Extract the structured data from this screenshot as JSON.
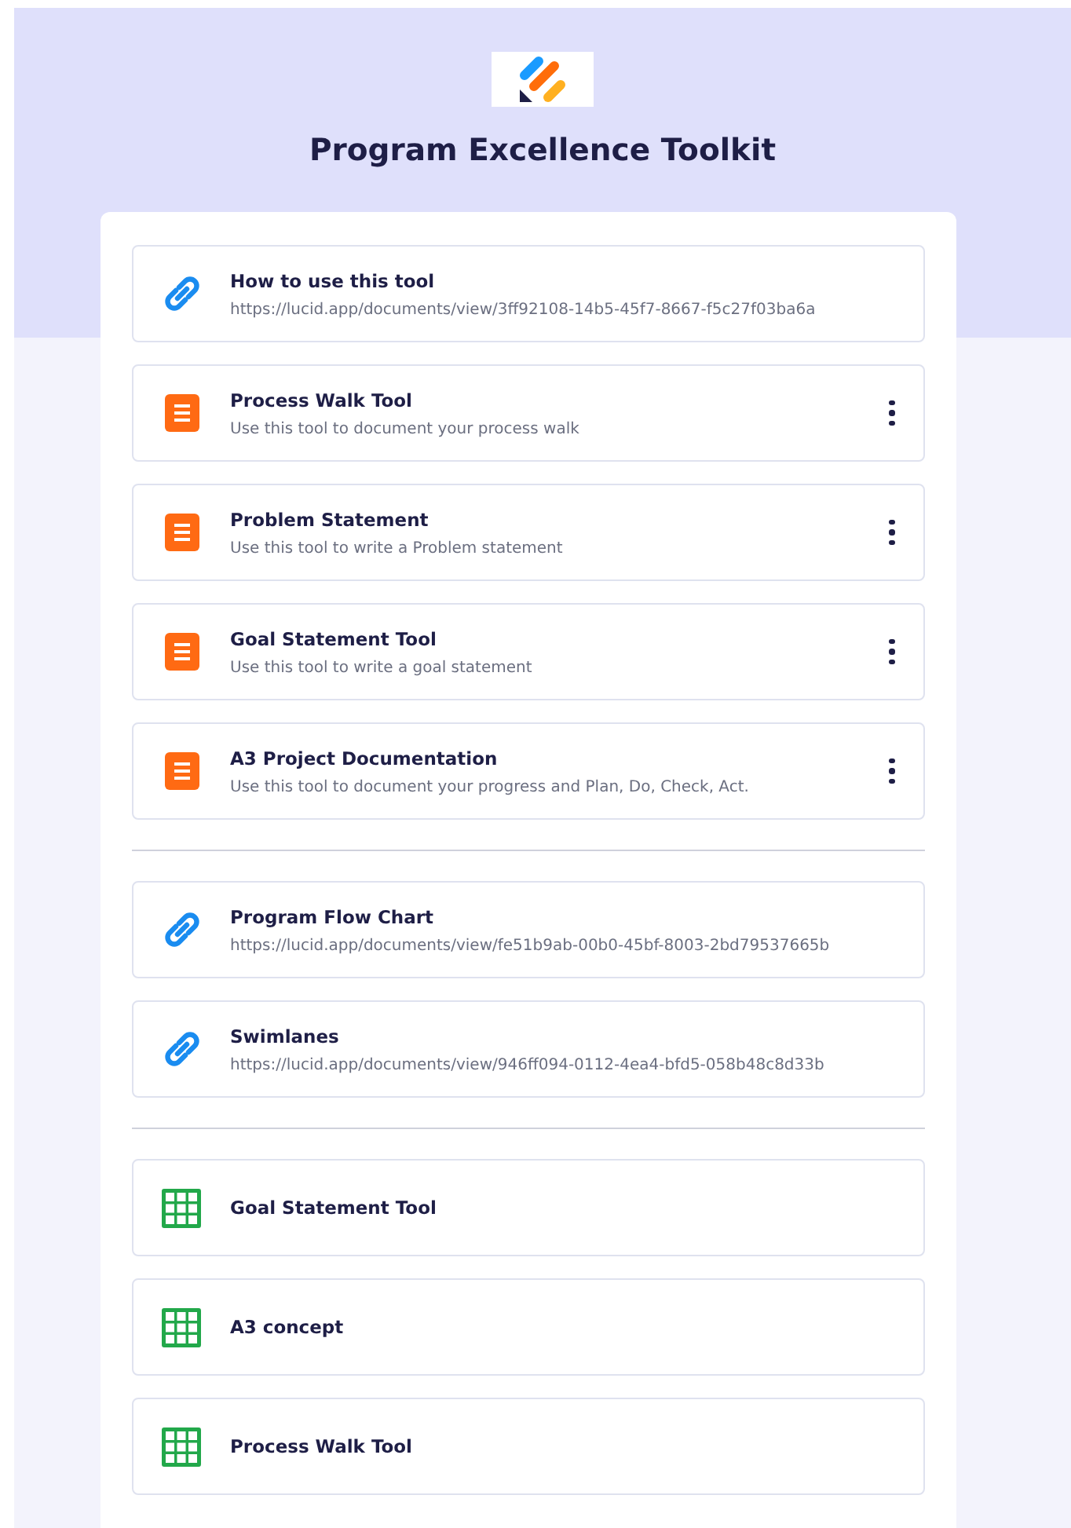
{
  "header": {
    "title": "Program Excellence Toolkit"
  },
  "groups": [
    {
      "items": [
        {
          "kind": "link",
          "title": "How to use this tool",
          "subtitle": "https://lucid.app/documents/view/3ff92108-14b5-45f7-8667-f5c27f03ba6a",
          "menu": false
        },
        {
          "kind": "doc",
          "title": "Process Walk Tool",
          "subtitle": "Use this tool to document your process walk",
          "menu": true
        },
        {
          "kind": "doc",
          "title": "Problem Statement",
          "subtitle": "Use this tool to write a Problem statement",
          "menu": true
        },
        {
          "kind": "doc",
          "title": "Goal Statement Tool",
          "subtitle": "Use this tool to write a goal statement",
          "menu": true
        },
        {
          "kind": "doc",
          "title": "A3 Project Documentation",
          "subtitle": "Use this tool to document your progress and Plan, Do, Check, Act.",
          "menu": true
        }
      ]
    },
    {
      "items": [
        {
          "kind": "link",
          "title": "Program Flow Chart",
          "subtitle": "https://lucid.app/documents/view/fe51b9ab-00b0-45bf-8003-2bd79537665b",
          "menu": false
        },
        {
          "kind": "link",
          "title": "Swimlanes",
          "subtitle": "https://lucid.app/documents/view/946ff094-0112-4ea4-bfd5-058b48c8d33b",
          "menu": false
        }
      ]
    },
    {
      "items": [
        {
          "kind": "sheet",
          "title": "Goal Statement Tool",
          "menu": false
        },
        {
          "kind": "sheet",
          "title": "A3 concept",
          "menu": false
        },
        {
          "kind": "sheet",
          "title": "Process Walk Tool",
          "menu": false
        }
      ]
    }
  ]
}
